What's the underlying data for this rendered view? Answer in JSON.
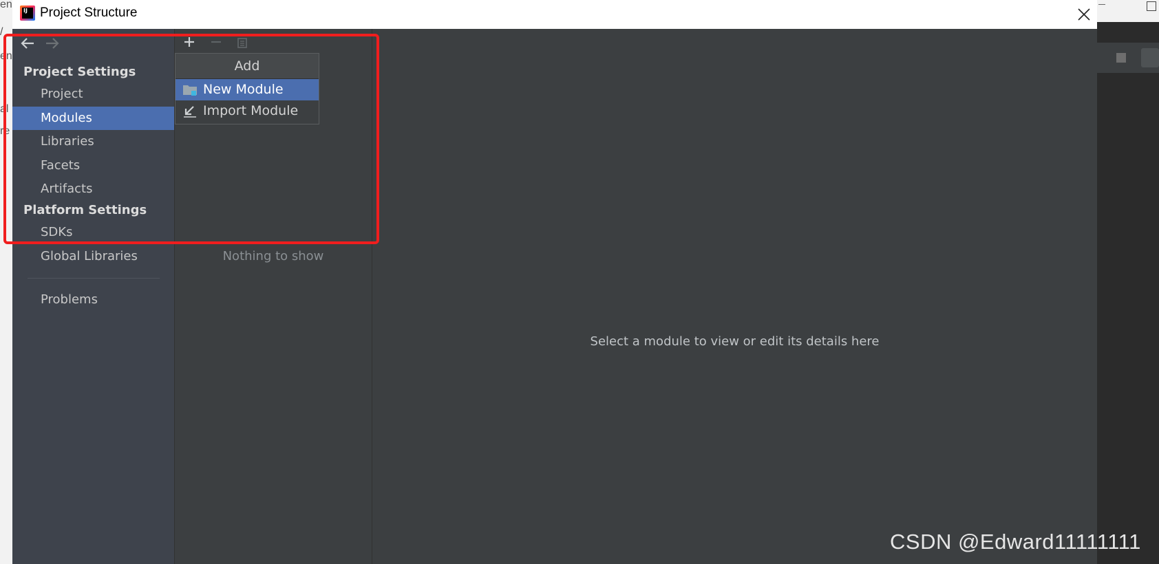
{
  "window": {
    "title": "Project Structure",
    "app_icon_text": "IJ"
  },
  "background_fragments": [
    "en",
    "/",
    "en",
    "al",
    "re"
  ],
  "sidebar": {
    "groups": [
      {
        "heading": "Project Settings",
        "items": [
          "Project",
          "Modules",
          "Libraries",
          "Facets",
          "Artifacts"
        ]
      },
      {
        "heading": "Platform Settings",
        "items": [
          "SDKs",
          "Global Libraries"
        ]
      }
    ],
    "problems": "Problems",
    "selected": "Modules"
  },
  "middle": {
    "empty_text": "Nothing to show"
  },
  "add_popup": {
    "title": "Add",
    "items": [
      "New Module",
      "Import Module"
    ],
    "selected": "New Module"
  },
  "detail": {
    "message": "Select a module to view or edit its details here"
  },
  "watermark": "CSDN @Edward11111111",
  "colors": {
    "selection": "#4b6eaf",
    "annotation": "#f01e1e",
    "sidebar_bg": "#3e434c",
    "panel_bg": "#3c3f41"
  }
}
